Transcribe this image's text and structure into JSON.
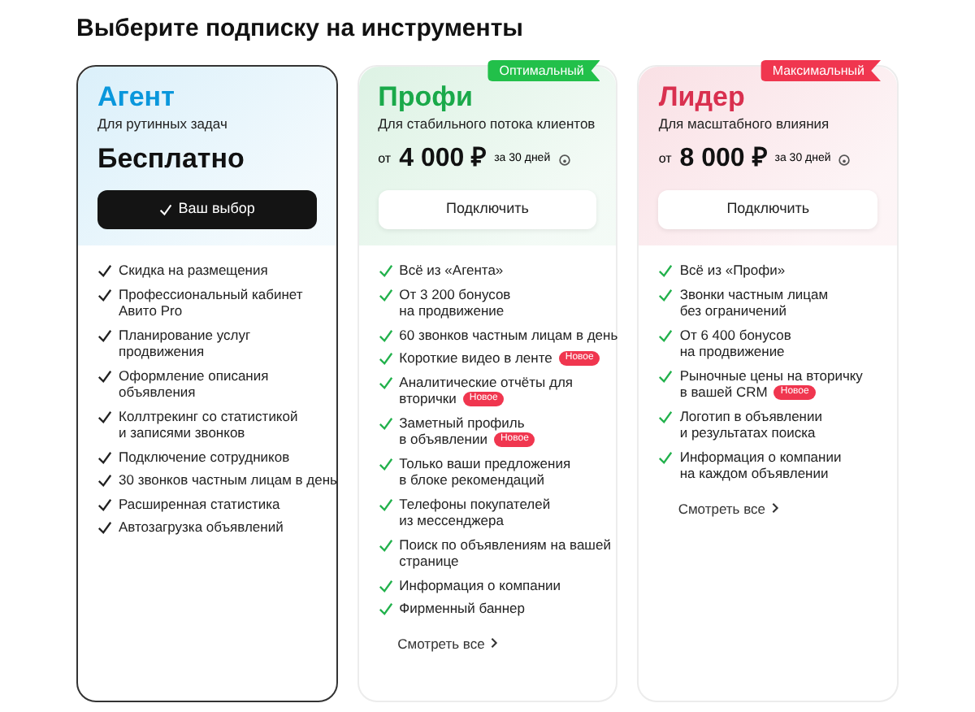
{
  "heading": "Выберите подписку на инструменты",
  "plans": [
    {
      "name": "Агент",
      "color": "#0a97dc",
      "selected": true,
      "subtitle": "Для рутинных задач",
      "price": {
        "amount": "Бесплатно"
      },
      "button": "Ваш выбор",
      "features": [
        {
          "lines": [
            "Скидка на размещения"
          ]
        },
        {
          "lines": [
            "Профессиональный кабинет",
            "Авито Pro"
          ]
        },
        {
          "lines": [
            "Планирование услуг",
            "продвижения"
          ]
        },
        {
          "lines": [
            "Оформление описания",
            "объявления"
          ]
        },
        {
          "lines": [
            "Коллтрекинг со статистикой",
            "и записями звонков"
          ]
        },
        {
          "lines": [
            "Подключение сотрудников"
          ]
        },
        {
          "lines": [
            "30 звонков частным лицам в день"
          ]
        },
        {
          "lines": [
            "Расширенная статистика"
          ]
        },
        {
          "lines": [
            "Автозагрузка объявлений"
          ]
        }
      ]
    },
    {
      "name": "Профи",
      "color": "#1aa94a",
      "selected": false,
      "subtitle": "Для стабильного потока клиентов",
      "price": {
        "prefix": "от",
        "amount": "4 000 ₽",
        "period": "за 30 дней"
      },
      "ribbon": {
        "text": "Оптимальный",
        "color": "#22c04a"
      },
      "button": "Подключить",
      "features": [
        {
          "lines": [
            "Всё из «Агента»"
          ]
        },
        {
          "lines": [
            "От 3 200 бонусов",
            "на продвижение"
          ]
        },
        {
          "lines": [
            "60 звонков частным лицам в день"
          ]
        },
        {
          "lines": [
            "Короткие видео в ленте"
          ],
          "badge": "Новое"
        },
        {
          "lines": [
            "Аналитические отчёты для",
            "вторички"
          ],
          "badge": "Новое"
        },
        {
          "lines": [
            "Заметный профиль",
            "в объявлении"
          ],
          "badge": "Новое"
        },
        {
          "lines": [
            "Только ваши предложения",
            "в блоке рекомендаций"
          ]
        },
        {
          "lines": [
            "Телефоны покупателей",
            "из мессенджера"
          ]
        },
        {
          "lines": [
            "Поиск по объявлениям на вашей",
            "странице"
          ]
        },
        {
          "lines": [
            "Информация о компании"
          ]
        },
        {
          "lines": [
            "Фирменный баннер"
          ]
        }
      ],
      "more": "Смотреть все"
    },
    {
      "name": "Лидер",
      "color": "#d9304f",
      "selected": false,
      "subtitle": "Для масштабного влияния",
      "price": {
        "prefix": "от",
        "amount": "8 000 ₽",
        "period": "за 30 дней"
      },
      "ribbon": {
        "text": "Максимальный",
        "color": "#f0364f"
      },
      "button": "Подключить",
      "features": [
        {
          "lines": [
            "Всё из «Профи»"
          ]
        },
        {
          "lines": [
            "Звонки частным лицам",
            "без ограничений"
          ]
        },
        {
          "lines": [
            "От 6 400 бонусов",
            "на продвижение"
          ]
        },
        {
          "lines": [
            "Рыночные цены на вторичку",
            "в вашей CRM"
          ],
          "badge": "Новое"
        },
        {
          "lines": [
            "Логотип в объявлении",
            "и результатах поиска"
          ]
        },
        {
          "lines": [
            "Информация о компании",
            "на каждом объявлении"
          ]
        }
      ],
      "more": "Смотреть все"
    }
  ]
}
